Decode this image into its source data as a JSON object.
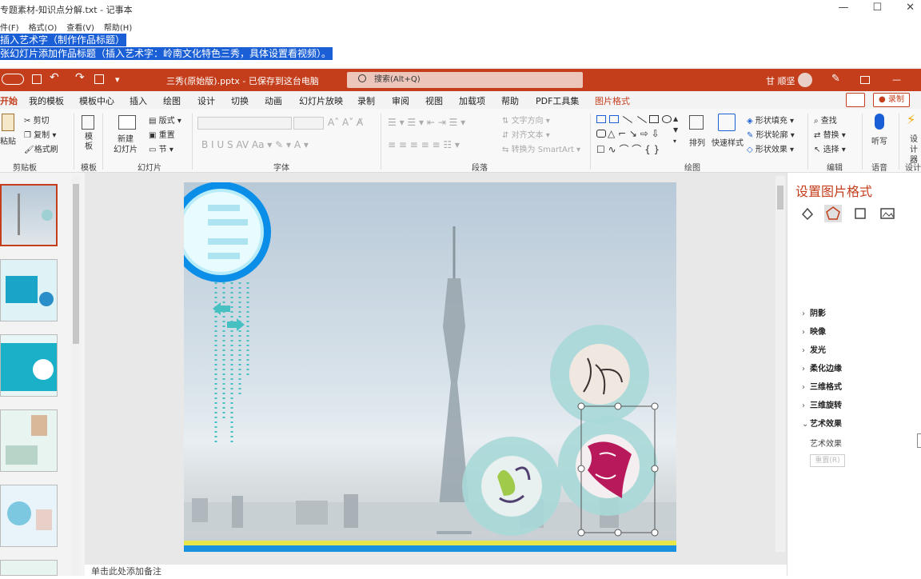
{
  "notepad": {
    "title": "专题素材-知识点分解.txt - 记事本",
    "menu": [
      "件(F)",
      "格式(O)",
      "查看(V)",
      "帮助(H)"
    ],
    "lines": [
      "插入艺术字（制作作品标题）",
      "张幻灯片添加作品标题（插入艺术字：岭南文化特色三秀，具体设置看视频）。"
    ],
    "min": "—",
    "max": "☐",
    "close": "✕"
  },
  "ppt": {
    "title": "三秀(原始版).pptx - 已保存到这台电脑",
    "search_placeholder": "搜索(Alt+Q)",
    "user": "甘 顺坚",
    "tabs": [
      "开始",
      "我的模板",
      "模板中心",
      "插入",
      "绘图",
      "设计",
      "切换",
      "动画",
      "幻灯片放映",
      "录制",
      "审阅",
      "视图",
      "加载项",
      "帮助",
      "PDF工具集",
      "图片格式"
    ],
    "record_btn": "录制",
    "ribbon": {
      "paste": "粘贴",
      "cut": "剪切",
      "copy": "复制",
      "format_painter": "格式刷",
      "group_clipboard": "剪贴板",
      "template": "模\n板",
      "group_template": "模板",
      "new_slide": "新建\n幻灯片",
      "layout": "版式",
      "reset": "重置",
      "section": "节",
      "group_slides": "幻灯片",
      "group_font": "字体",
      "text_direction": "文字方向",
      "align_text": "对齐文本",
      "smartart": "转换为 SmartArt",
      "group_paragraph": "段落",
      "arrange": "排列",
      "quick_styles": "快速样式",
      "shape_fill": "形状填充",
      "shape_outline": "形状轮廓",
      "shape_effects": "形状效果",
      "group_drawing": "绘图",
      "find": "查找",
      "replace": "替换",
      "select": "选择",
      "group_editing": "编辑",
      "dictate": "听写",
      "group_voice": "语音",
      "designer": "设\n计器",
      "group_designer": "设计"
    },
    "notes_placeholder": "单击此处添加备注",
    "pane": {
      "title": "设置图片格式",
      "sections": [
        "阴影",
        "映像",
        "发光",
        "柔化边缘",
        "三维格式",
        "三维旋转",
        "艺术效果"
      ],
      "art_effects_label": "艺术效果",
      "reset": "重置(R)"
    },
    "colors": {
      "accent": "#c43e1c",
      "title_bar": "#c43e1c"
    }
  }
}
